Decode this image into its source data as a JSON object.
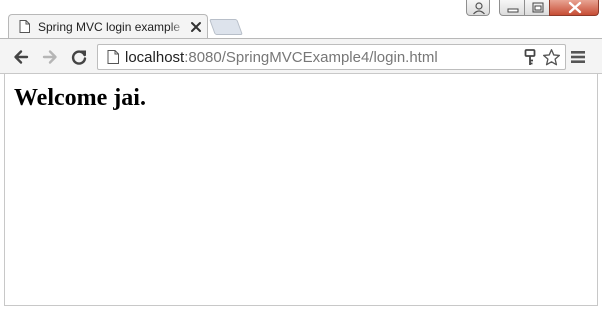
{
  "browser": {
    "tab": {
      "title": "Spring MVC login example",
      "icon": "document-icon",
      "close_icon": "close-icon"
    },
    "window_controls": [
      "user-icon",
      "minimize-icon",
      "maximize-icon",
      "close-icon"
    ],
    "toolbar": {
      "back_icon": "arrow-left-icon",
      "forward_icon": "arrow-right-icon",
      "reload_icon": "reload-icon",
      "url_host": "localhost",
      "url_rest": ":8080/SpringMVCExample4/login.html",
      "page_icon": "document-icon",
      "key_icon": "key-icon",
      "bookmark_icon": "star-icon",
      "menu_icon": "hamburger-menu-icon"
    }
  },
  "page": {
    "heading": "Welcome jai."
  },
  "colors": {
    "close_button": "#c74d35",
    "toolbar_bg": "#f4f4f4"
  }
}
